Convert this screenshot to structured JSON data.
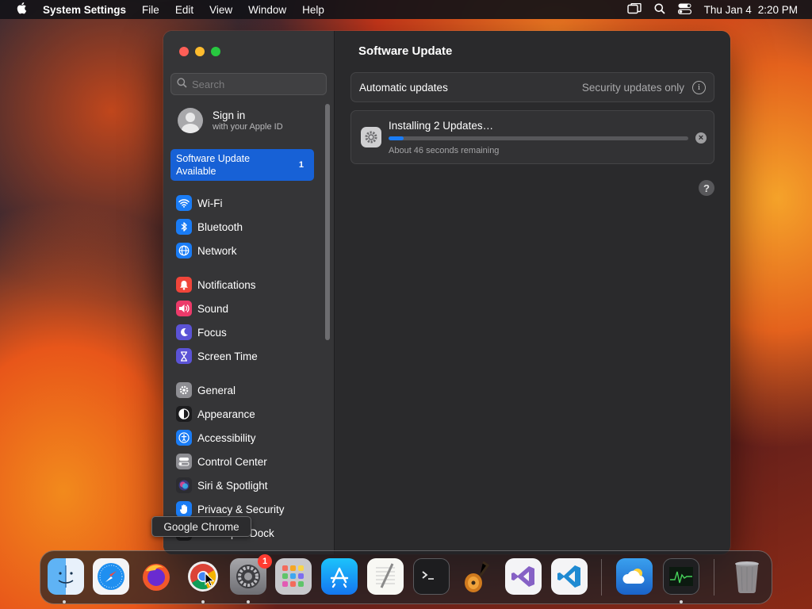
{
  "menubar": {
    "app_name": "System Settings",
    "items": [
      "File",
      "Edit",
      "View",
      "Window",
      "Help"
    ],
    "date": "Thu Jan 4",
    "time": "2:20 PM"
  },
  "sidebar": {
    "search_placeholder": "Search",
    "signin_title": "Sign in",
    "signin_subtitle": "with your Apple ID",
    "update_available_label": "Software Update Available",
    "update_available_count": "1",
    "groups": [
      {
        "items": [
          {
            "label": "Wi-Fi",
            "icon": "wifi-icon",
            "color": "#1a7cf5"
          },
          {
            "label": "Bluetooth",
            "icon": "bluetooth-icon",
            "color": "#1a7cf5"
          },
          {
            "label": "Network",
            "icon": "network-globe-icon",
            "color": "#1a7cf5"
          }
        ]
      },
      {
        "items": [
          {
            "label": "Notifications",
            "icon": "bell-icon",
            "color": "#f0453a"
          },
          {
            "label": "Sound",
            "icon": "speaker-icon",
            "color": "#ec3a6a"
          },
          {
            "label": "Focus",
            "icon": "moon-icon",
            "color": "#5b53d6"
          },
          {
            "label": "Screen Time",
            "icon": "hourglass-icon",
            "color": "#5b53d6"
          }
        ]
      },
      {
        "items": [
          {
            "label": "General",
            "icon": "gear-icon",
            "color": "#8e8e93"
          },
          {
            "label": "Appearance",
            "icon": "appearance-icon",
            "color": "#1c1c1e"
          },
          {
            "label": "Accessibility",
            "icon": "accessibility-icon",
            "color": "#1a7cf5"
          },
          {
            "label": "Control Center",
            "icon": "toggles-icon",
            "color": "#8e8e93"
          },
          {
            "label": "Siri & Spotlight",
            "icon": "siri-icon",
            "color": "#2c2c30"
          },
          {
            "label": "Privacy & Security",
            "icon": "hand-icon",
            "color": "#1a7cf5"
          },
          {
            "label": "Desktop & Dock",
            "icon": "desktop-icon",
            "color": "#1c1c1e"
          }
        ]
      }
    ]
  },
  "content": {
    "title": "Software Update",
    "automatic_label": "Automatic updates",
    "automatic_value": "Security updates only",
    "installing_title": "Installing 2 Updates…",
    "installing_subtitle": "About 46 seconds remaining",
    "progress_fraction": 0.05
  },
  "tooltip": "Google Chrome",
  "dock": [
    {
      "name": "finder",
      "icon": "finder-icon",
      "running": true
    },
    {
      "name": "safari",
      "icon": "safari-compass-icon",
      "running": false
    },
    {
      "name": "firefox",
      "icon": "firefox-icon",
      "running": false
    },
    {
      "name": "chrome",
      "icon": "chrome-icon",
      "running": true
    },
    {
      "name": "system-settings",
      "icon": "settings-gear-icon",
      "running": true,
      "badge": "1"
    },
    {
      "name": "launchpad",
      "icon": "launchpad-grid-icon",
      "running": false
    },
    {
      "name": "app-store",
      "icon": "app-store-icon",
      "running": false
    },
    {
      "name": "textedit",
      "icon": "textedit-icon",
      "running": false
    },
    {
      "name": "terminal",
      "icon": "terminal-icon",
      "running": false
    },
    {
      "name": "garageband",
      "icon": "guitar-icon",
      "running": false
    },
    {
      "name": "visual-studio",
      "icon": "visual-studio-icon",
      "running": false
    },
    {
      "name": "vscode",
      "icon": "vscode-icon",
      "running": false
    },
    {
      "name": "weather",
      "icon": "weather-cloud-icon",
      "running": false
    },
    {
      "name": "activity-monitor",
      "icon": "activity-monitor-icon",
      "running": true
    },
    {
      "name": "trash",
      "icon": "trash-icon",
      "running": false
    }
  ]
}
